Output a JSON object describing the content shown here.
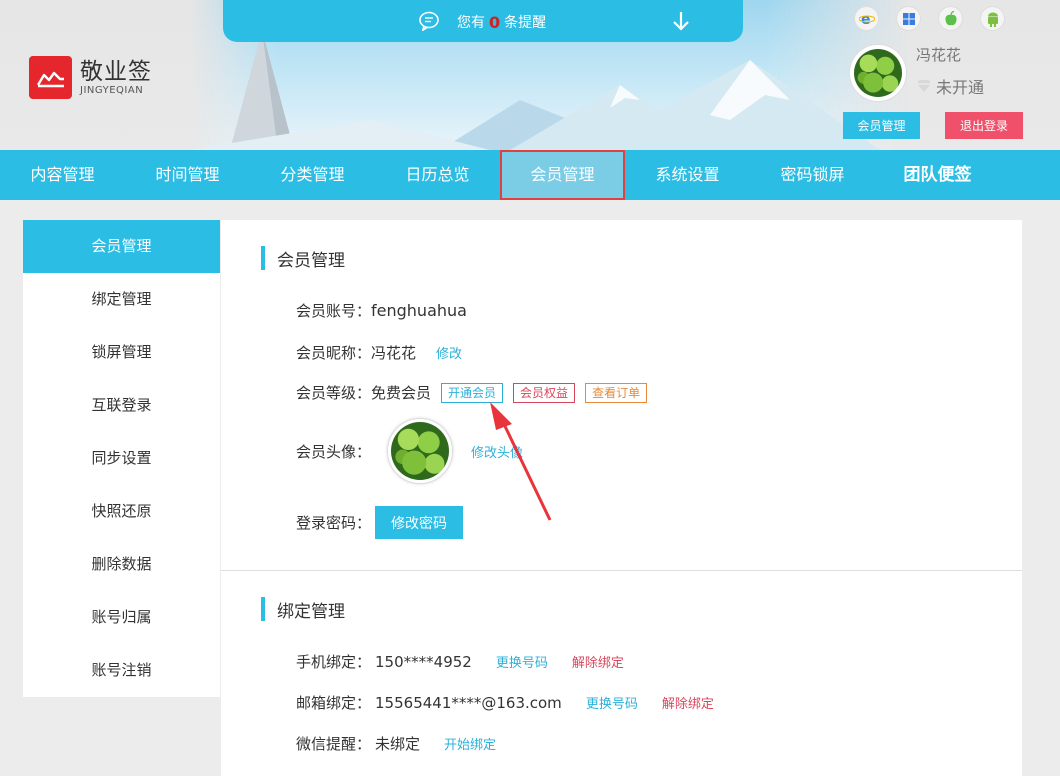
{
  "notice": {
    "prefix": "您有",
    "count": "0",
    "suffix": "条提醒"
  },
  "logo": {
    "cn": "敬业签",
    "en": "JINGYEQIAN"
  },
  "platforms": [
    "ie-icon",
    "windows-icon",
    "apple-icon",
    "android-icon"
  ],
  "user": {
    "name": "冯花花",
    "vip_status": "未开通",
    "member_btn": "会员管理",
    "logout_btn": "退出登录"
  },
  "nav": [
    "内容管理",
    "时间管理",
    "分类管理",
    "日历总览",
    "会员管理",
    "系统设置",
    "密码锁屏",
    "团队便签"
  ],
  "sidebar": [
    "会员管理",
    "绑定管理",
    "锁屏管理",
    "互联登录",
    "同步设置",
    "快照还原",
    "删除数据",
    "账号归属",
    "账号注销"
  ],
  "member": {
    "title": "会员管理",
    "account_label": "会员账号：",
    "account_value": "fenghuahua",
    "nickname_label": "会员昵称：",
    "nickname_value": "冯花花",
    "nickname_edit": "修改",
    "level_label": "会员等级：",
    "level_value": "免费会员",
    "tag_open": "开通会员",
    "tag_rights": "会员权益",
    "tag_orders": "查看订单",
    "avatar_label": "会员头像：",
    "avatar_edit": "修改头像",
    "password_label": "登录密码：",
    "password_btn": "修改密码"
  },
  "binding": {
    "title": "绑定管理",
    "phone_label": "手机绑定：",
    "phone_value": "150****4952",
    "phone_change": "更换号码",
    "phone_unbind": "解除绑定",
    "email_label": "邮箱绑定：",
    "email_value": "15565441****@163.com",
    "email_change": "更换号码",
    "email_unbind": "解除绑定",
    "wechat_label": "微信提醒：",
    "wechat_value": "未绑定",
    "wechat_bind": "开始绑定"
  },
  "colors": {
    "accent": "#2cbde5",
    "danger": "#f0506a",
    "brand_red": "#e5262c"
  }
}
